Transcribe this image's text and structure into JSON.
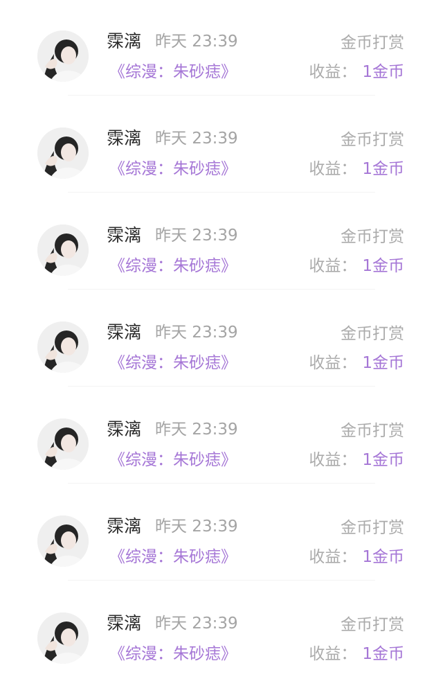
{
  "colors": {
    "accent": "#a576d6",
    "muted": "#ababab",
    "name": "#2b2b2b"
  },
  "notifications": [
    {
      "avatar_icon": "user-avatar-icon",
      "user_name": "霂漓",
      "time": "昨天 23:39",
      "type": "金币打赏",
      "book_title": "《综漫：朱砂痣》",
      "earnings_label": "收益：",
      "earnings_value": "1金币"
    },
    {
      "avatar_icon": "user-avatar-icon",
      "user_name": "霂漓",
      "time": "昨天 23:39",
      "type": "金币打赏",
      "book_title": "《综漫：朱砂痣》",
      "earnings_label": "收益：",
      "earnings_value": "1金币"
    },
    {
      "avatar_icon": "user-avatar-icon",
      "user_name": "霂漓",
      "time": "昨天 23:39",
      "type": "金币打赏",
      "book_title": "《综漫：朱砂痣》",
      "earnings_label": "收益：",
      "earnings_value": "1金币"
    },
    {
      "avatar_icon": "user-avatar-icon",
      "user_name": "霂漓",
      "time": "昨天 23:39",
      "type": "金币打赏",
      "book_title": "《综漫：朱砂痣》",
      "earnings_label": "收益：",
      "earnings_value": "1金币"
    },
    {
      "avatar_icon": "user-avatar-icon",
      "user_name": "霂漓",
      "time": "昨天 23:39",
      "type": "金币打赏",
      "book_title": "《综漫：朱砂痣》",
      "earnings_label": "收益：",
      "earnings_value": "1金币"
    },
    {
      "avatar_icon": "user-avatar-icon",
      "user_name": "霂漓",
      "time": "昨天 23:39",
      "type": "金币打赏",
      "book_title": "《综漫：朱砂痣》",
      "earnings_label": "收益：",
      "earnings_value": "1金币"
    },
    {
      "avatar_icon": "user-avatar-icon",
      "user_name": "霂漓",
      "time": "昨天 23:39",
      "type": "金币打赏",
      "book_title": "《综漫：朱砂痣》",
      "earnings_label": "收益：",
      "earnings_value": "1金币"
    }
  ]
}
